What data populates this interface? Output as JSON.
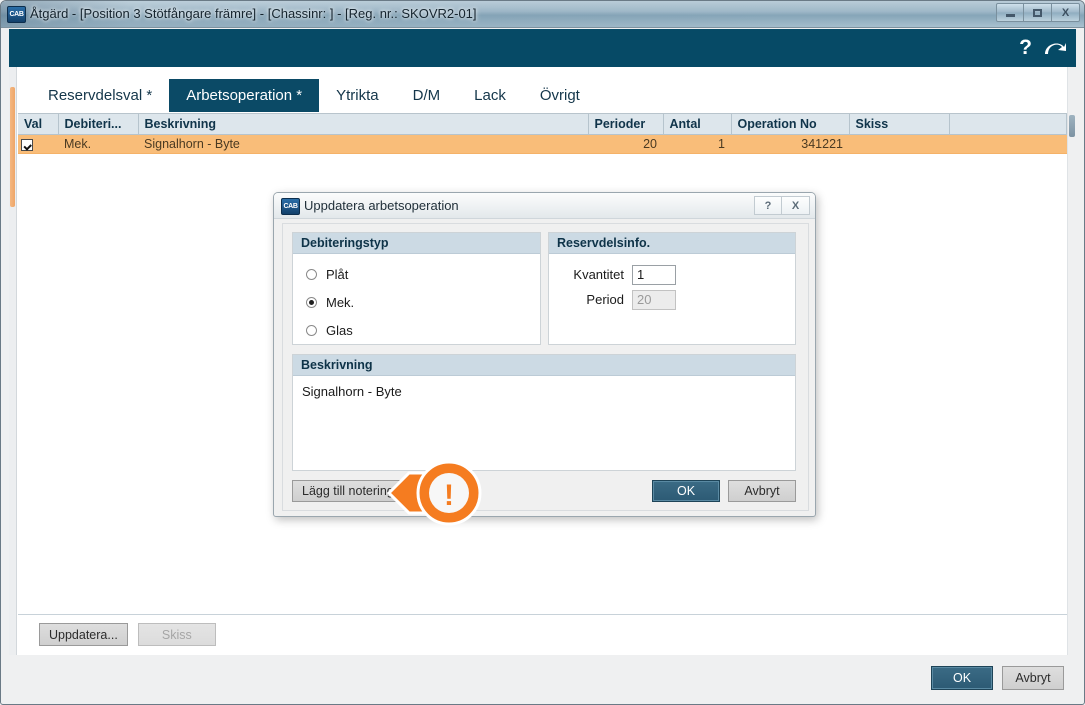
{
  "window": {
    "title": "Åtgärd - [Position 3 Stötfångare främre] - [Chassinr: ] - [Reg. nr.: SKOVR2-01]",
    "app_icon": "cab-app-icon",
    "icon_text": "CAB",
    "controls": {
      "minimize": "minimize-icon",
      "maximize": "maximize-icon",
      "close_label": "X"
    }
  },
  "header": {
    "help_label": "?",
    "help_icon": "question-mark-icon",
    "undo_icon": "undo-arrow-icon"
  },
  "tabs": [
    {
      "label": "Reservdelsval *",
      "active": false
    },
    {
      "label": "Arbetsoperation *",
      "active": true
    },
    {
      "label": "Ytrikta",
      "active": false
    },
    {
      "label": "D/M",
      "active": false
    },
    {
      "label": "Lack",
      "active": false
    },
    {
      "label": "Övrigt",
      "active": false
    }
  ],
  "grid": {
    "columns": [
      "Val",
      "Debiteri...",
      "Beskrivning",
      "Perioder",
      "Antal",
      "Operation No",
      "Skiss",
      ""
    ],
    "rows": [
      {
        "selected": true,
        "debiteringstyp": "Mek.",
        "beskrivning": "Signalhorn - Byte",
        "perioder": "20",
        "antal": "1",
        "operation_no": "341221",
        "skiss": "",
        "extra": ""
      }
    ],
    "row_highlight_color": "#f9bd79",
    "header_color": "#dde6ec"
  },
  "content_toolbar": {
    "update_label": "Uppdatera...",
    "sketch_label": "Skiss",
    "sketch_disabled": true
  },
  "footer": {
    "ok_label": "OK",
    "cancel_label": "Avbryt"
  },
  "dialog": {
    "title": "Uppdatera arbetsoperation",
    "icon_text": "CAB",
    "help_label": "?",
    "close_label": "X",
    "groups": {
      "debiteringstyp": {
        "header": "Debiteringstyp",
        "options": [
          {
            "label": "Plåt",
            "checked": false
          },
          {
            "label": "Mek.",
            "checked": true
          },
          {
            "label": "Glas",
            "checked": false
          }
        ]
      },
      "reservdelsinfo": {
        "header": "Reservdelsinfo.",
        "fields": [
          {
            "label": "Kvantitet",
            "value": "1",
            "disabled": false
          },
          {
            "label": "Period",
            "value": "20",
            "disabled": true
          }
        ]
      },
      "beskrivning": {
        "header": "Beskrivning",
        "text": "Signalhorn - Byte"
      }
    },
    "buttons": {
      "add_note_label": "Lägg till notering",
      "ok_label": "OK",
      "cancel_label": "Avbryt"
    }
  },
  "callout": {
    "glyph": "!",
    "color": "#f57c20",
    "points_to": "Lägg till notering"
  },
  "colors": {
    "brand_header": "#064a66",
    "active_tab": "#0b4a66",
    "group_header": "#ccdae4",
    "row_highlight": "#f9bd79",
    "primary_button": "#2c5a74",
    "callout_orange": "#f57c20"
  }
}
